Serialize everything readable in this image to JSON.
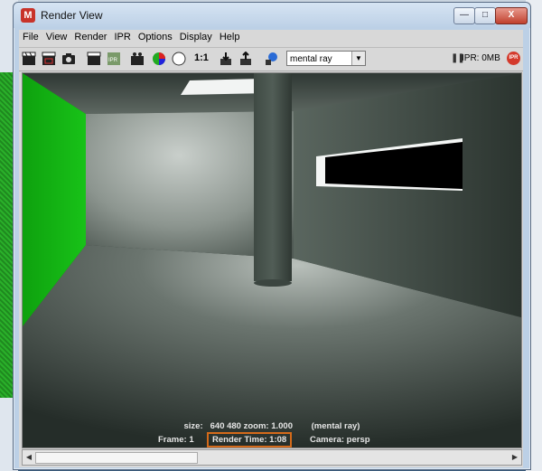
{
  "window": {
    "title": "Render View"
  },
  "menu": [
    "File",
    "View",
    "Render",
    "IPR",
    "Options",
    "Display",
    "Help"
  ],
  "toolbar": {
    "one_to_one": "1:1",
    "renderer": "mental ray",
    "ipr_status": "IPR: 0MB",
    "ipr_badge": "IPR"
  },
  "render_info": {
    "size_label": "size:",
    "size_value": "640  480 zoom: 1.000",
    "renderer": "(mental ray)",
    "frame": "Frame: 1",
    "render_time": "Render Time:  1:08",
    "camera": "Camera: persp"
  },
  "colors": {
    "accent": "#d46a1a",
    "wall_green": "#18c218",
    "title_close": "#c0412e"
  }
}
